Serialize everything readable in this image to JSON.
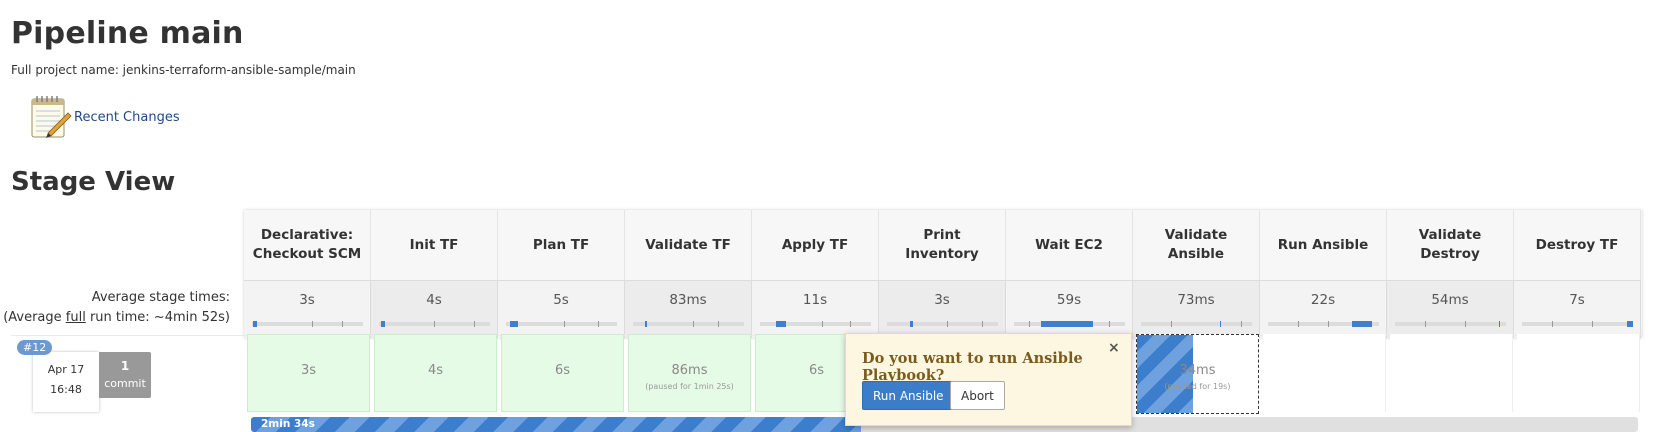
{
  "header": {
    "title": "Pipeline main",
    "full_name": "Full project name: jenkins-terraform-ansible-sample/main",
    "recent_changes": "Recent Changes"
  },
  "stage_view": {
    "title": "Stage View",
    "avg_label_line1": "Average stage times:",
    "avg_label_pre": "(Average ",
    "avg_label_full": "full",
    "avg_label_post": " run time: ~4min 52s)",
    "stages": [
      {
        "name": "Declarative: Checkout SCM",
        "avg": "3s"
      },
      {
        "name": "Init TF",
        "avg": "4s"
      },
      {
        "name": "Plan TF",
        "avg": "5s"
      },
      {
        "name": "Validate TF",
        "avg": "83ms"
      },
      {
        "name": "Apply TF",
        "avg": "11s"
      },
      {
        "name": "Print Inventory",
        "avg": "3s"
      },
      {
        "name": "Wait EC2",
        "avg": "59s"
      },
      {
        "name": "Validate Ansible",
        "avg": "73ms"
      },
      {
        "name": "Run Ansible",
        "avg": "22s"
      },
      {
        "name": "Validate Destroy",
        "avg": "54ms"
      },
      {
        "name": "Destroy TF",
        "avg": "7s"
      }
    ],
    "run": {
      "badge": "#12",
      "date": "Apr 17",
      "time": "16:48",
      "commit_count": "1",
      "commit_label": "commit",
      "cells": [
        {
          "time": "3s",
          "note": ""
        },
        {
          "time": "4s",
          "note": ""
        },
        {
          "time": "6s",
          "note": ""
        },
        {
          "time": "86ms",
          "note": "(paused for 1min 25s)"
        },
        {
          "time": "6s",
          "note": ""
        },
        {
          "time": "",
          "note": ""
        },
        {
          "time": "",
          "note": ""
        },
        {
          "time": "34ms",
          "note": "(paused for 19s)"
        },
        {
          "time": "",
          "note": ""
        },
        {
          "time": "",
          "note": ""
        },
        {
          "time": "",
          "note": ""
        }
      ]
    },
    "progress": {
      "label": "2min 34s",
      "fraction": 0.44
    }
  },
  "input_prompt": {
    "question": "Do you want to run Ansible Playbook?",
    "close": "×",
    "proceed_label": "Run Ansible",
    "abort_label": "Abort"
  },
  "colors": {
    "success_cell": "#e6fbe6",
    "accent_blue": "#3b7dc9",
    "prompt_bg": "#fdf7e1"
  }
}
